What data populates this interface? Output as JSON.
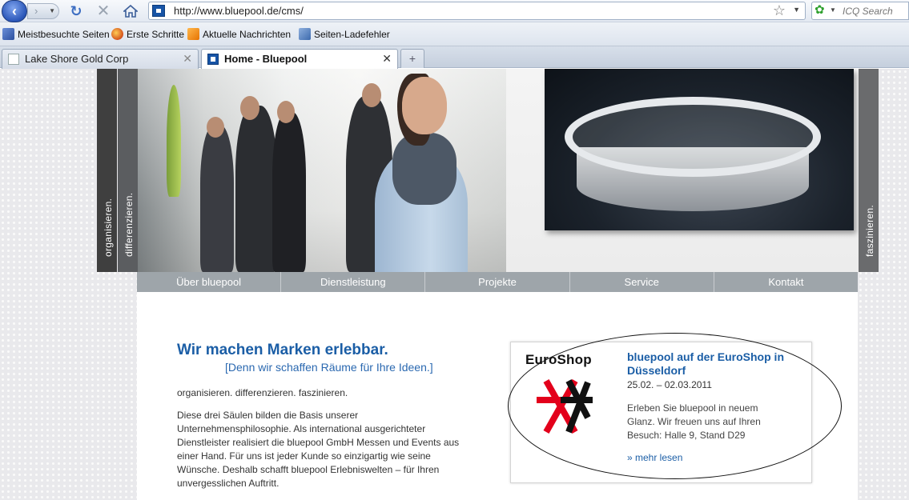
{
  "browser": {
    "url": "http://www.bluepool.de/cms/",
    "search_placeholder": "ICQ Search",
    "bookmarks": [
      "Meistbesuchte Seiten",
      "Erste Schritte",
      "Aktuelle Nachrichten",
      "Seiten-Ladefehler"
    ],
    "tabs": [
      {
        "label": "Lake Shore Gold Corp",
        "active": false
      },
      {
        "label": "Home - Bluepool",
        "active": true
      }
    ],
    "new_tab_symbol": "+"
  },
  "icons": [
    "back-icon",
    "forward-icon",
    "reload-icon",
    "stop-icon",
    "home-icon",
    "star-icon",
    "icq-icon",
    "close-icon",
    "euroshop-logo"
  ],
  "hero": {
    "strips": [
      "organisieren.",
      "differenzieren.",
      "faszinieren."
    ]
  },
  "nav": {
    "items": [
      "Über bluepool",
      "Dienstleistung",
      "Projekte",
      "Service",
      "Kontakt"
    ]
  },
  "main": {
    "headline": "Wir machen Marken erlebbar.",
    "subheadline": "[Denn wir schaffen Räume für Ihre Ideen.]",
    "tagline": "organisieren. differenzieren. faszinieren.",
    "body": "Diese drei Säulen bilden die Basis unserer Unternehmensphilosophie. Als international ausgerichteter Dienstleister realisiert die bluepool GmbH Messen und Events aus einer Hand. Für uns ist jeder Kunde so einzigartig wie seine Wünsche. Deshalb schafft bluepool Erlebniswelten – für Ihren unvergesslichen Auftritt."
  },
  "news": {
    "logo_text": "EuroShop",
    "title": "bluepool auf der EuroShop in Düsseldorf",
    "date": "25.02. – 02.03.2011",
    "text": "Erleben Sie bluepool in neuem Glanz. Wir freuen uns auf Ihren Besuch: Halle 9, Stand D29",
    "link": "» mehr lesen"
  },
  "colors": {
    "link_blue": "#1b5ea6",
    "nav_gray": "#9ea5aa",
    "euroshop_red": "#e3001b"
  }
}
